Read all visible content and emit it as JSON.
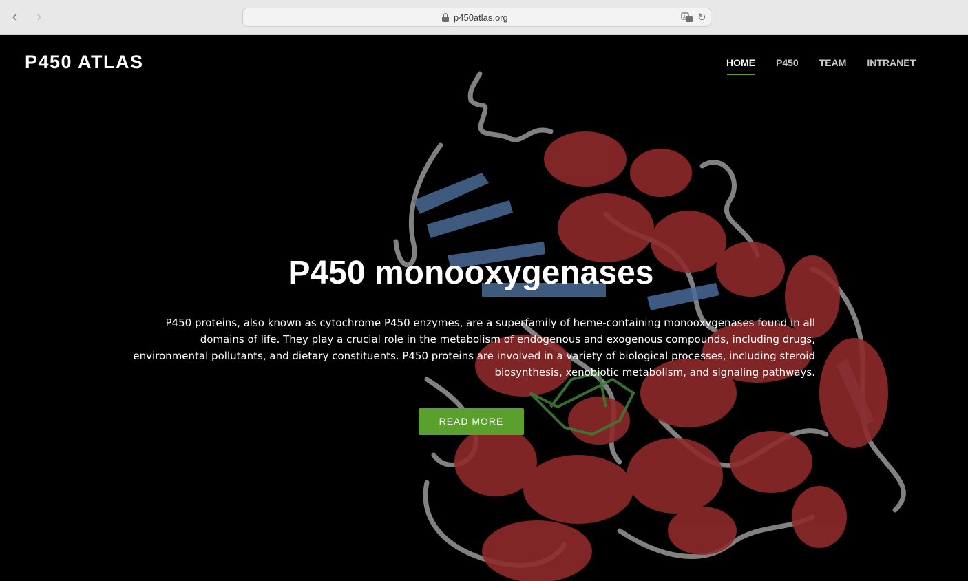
{
  "browser": {
    "url": "p450atlas.org",
    "back_icon": "chevron-left-icon",
    "forward_icon": "chevron-right-icon"
  },
  "header": {
    "brand": "P450 ATLAS",
    "nav": [
      {
        "label": "HOME",
        "active": true
      },
      {
        "label": "P450",
        "active": false
      },
      {
        "label": "TEAM",
        "active": false
      },
      {
        "label": "INTRANET",
        "active": false
      }
    ]
  },
  "hero": {
    "title": "P450 monooxygenases",
    "text": "P450 proteins, also known as cytochrome P450 enzymes, are a superfamily of heme-containing monooxygenases found in all domains of life. They play a crucial role in the metabolism of endogenous and exogenous compounds, including drugs, environmental pollutants, and dietary constituents. P450 proteins are involved in a variety of biological processes, including steroid biosynthesis, xenobiotic metabolism, and signaling pathways.",
    "button": "READ MORE"
  },
  "colors": {
    "accent": "#5aa02c",
    "helix": "#8e2a2a",
    "sheet": "#4a6a96",
    "coil": "#9a9a9a",
    "heme": "#3d7a35"
  }
}
